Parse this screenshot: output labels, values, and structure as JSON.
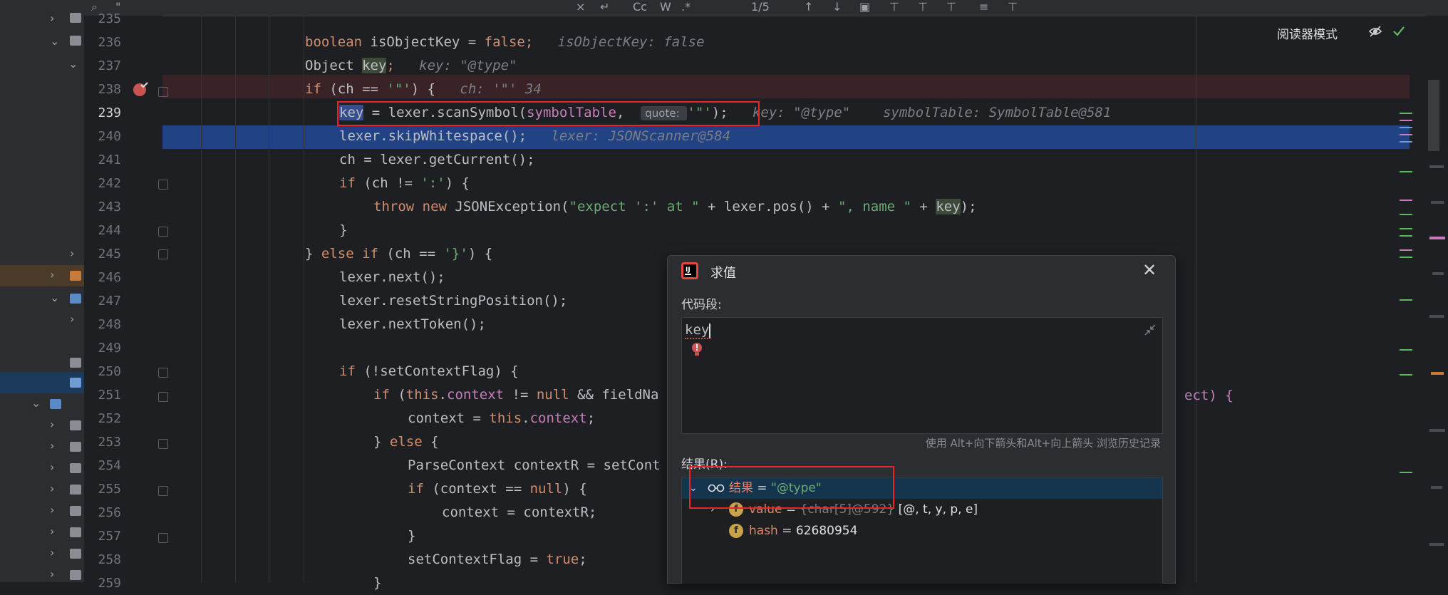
{
  "find_bar": {
    "query": "\"",
    "match_count": "1/5"
  },
  "reader_mode": {
    "label": "阅读器模式"
  },
  "lines": [
    {
      "num": "235",
      "parts": [
        {
          "t": "",
          "c": ""
        }
      ]
    },
    {
      "num": "236",
      "parts": [
        {
          "t": "boolean ",
          "c": "kw"
        },
        {
          "t": "isObjectKey = ",
          "c": ""
        },
        {
          "t": "false",
          "c": "kw"
        },
        {
          "t": ";",
          "c": "kw"
        },
        {
          "t": "   isObjectKey: false",
          "c": "hint"
        }
      ]
    },
    {
      "num": "237",
      "parts": [
        {
          "t": "Object ",
          "c": ""
        },
        {
          "t": "key",
          "c": "var-box"
        },
        {
          "t": ";",
          "c": "kw"
        },
        {
          "t": "   key: \"@type\"",
          "c": "hint"
        }
      ]
    },
    {
      "num": "238",
      "parts": [
        {
          "t": "if ",
          "c": "kw"
        },
        {
          "t": "(ch == ",
          "c": ""
        },
        {
          "t": "'\"'",
          "c": "str"
        },
        {
          "t": ") {",
          "c": ""
        },
        {
          "t": "   ch: '\"' 34",
          "c": "hint"
        }
      ]
    },
    {
      "num": "239",
      "parts": [
        {
          "t": "key",
          "c": "key-hl"
        },
        {
          "t": " = lexer.scanSymbol(",
          "c": ""
        },
        {
          "t": "symbolTable",
          "c": "fld"
        },
        {
          "t": ",  ",
          "c": ""
        },
        {
          "t": "quote: ",
          "c": "inlay-a"
        },
        {
          "t": "'\"'",
          "c": "str"
        },
        {
          "t": ");",
          "c": ""
        },
        {
          "t": "   key: \"@type\"    symbolTable: SymbolTable@581",
          "c": "hint"
        }
      ]
    },
    {
      "num": "240",
      "parts": [
        {
          "t": "lexer.skipWhitespace();",
          "c": ""
        },
        {
          "t": "   lexer: JSONScanner@584",
          "c": "hint"
        }
      ]
    },
    {
      "num": "241",
      "parts": [
        {
          "t": "ch = lexer.getCurrent();",
          "c": ""
        }
      ]
    },
    {
      "num": "242",
      "parts": [
        {
          "t": "if ",
          "c": "kw"
        },
        {
          "t": "(ch != ",
          "c": ""
        },
        {
          "t": "':'",
          "c": "str"
        },
        {
          "t": ") {",
          "c": ""
        }
      ]
    },
    {
      "num": "243",
      "parts": [
        {
          "t": "throw new ",
          "c": "kw"
        },
        {
          "t": "JSONException(",
          "c": ""
        },
        {
          "t": "\"expect ':' at \"",
          "c": "str"
        },
        {
          "t": " + lexer.pos() + ",
          "c": ""
        },
        {
          "t": "\", name \"",
          "c": "str"
        },
        {
          "t": " + ",
          "c": ""
        },
        {
          "t": "key",
          "c": "var-box"
        },
        {
          "t": ");",
          "c": ""
        }
      ]
    },
    {
      "num": "244",
      "parts": [
        {
          "t": "}",
          "c": ""
        }
      ]
    },
    {
      "num": "245",
      "parts": [
        {
          "t": "} ",
          "c": ""
        },
        {
          "t": "else if ",
          "c": "kw"
        },
        {
          "t": "(ch == ",
          "c": ""
        },
        {
          "t": "'}'",
          "c": "str"
        },
        {
          "t": ") {",
          "c": ""
        }
      ]
    },
    {
      "num": "246",
      "parts": [
        {
          "t": "lexer.next();",
          "c": ""
        }
      ]
    },
    {
      "num": "247",
      "parts": [
        {
          "t": "lexer.resetStringPosition();",
          "c": ""
        }
      ]
    },
    {
      "num": "248",
      "parts": [
        {
          "t": "lexer.nextToken();",
          "c": ""
        }
      ]
    },
    {
      "num": "249",
      "parts": [
        {
          "t": "",
          "c": ""
        }
      ]
    },
    {
      "num": "250",
      "parts": [
        {
          "t": "if ",
          "c": "kw"
        },
        {
          "t": "(!setContextFlag) {",
          "c": ""
        }
      ]
    },
    {
      "num": "251",
      "parts": [
        {
          "t": "if ",
          "c": "kw"
        },
        {
          "t": "(",
          "c": ""
        },
        {
          "t": "this",
          "c": "kw"
        },
        {
          "t": ".",
          "c": ""
        },
        {
          "t": "context",
          "c": "fld"
        },
        {
          "t": " != ",
          "c": ""
        },
        {
          "t": "null ",
          "c": "kw"
        },
        {
          "t": "&& fieldNa",
          "c": ""
        }
      ]
    },
    {
      "num": "252",
      "parts": [
        {
          "t": "context = ",
          "c": ""
        },
        {
          "t": "this",
          "c": "kw"
        },
        {
          "t": ".",
          "c": ""
        },
        {
          "t": "context",
          "c": "fld"
        },
        {
          "t": ";",
          "c": ""
        }
      ]
    },
    {
      "num": "253",
      "parts": [
        {
          "t": "} ",
          "c": ""
        },
        {
          "t": "else ",
          "c": "kw"
        },
        {
          "t": "{",
          "c": ""
        }
      ]
    },
    {
      "num": "254",
      "parts": [
        {
          "t": "ParseContext contextR = setCont",
          "c": ""
        }
      ]
    },
    {
      "num": "255",
      "parts": [
        {
          "t": "if ",
          "c": "kw"
        },
        {
          "t": "(context == ",
          "c": ""
        },
        {
          "t": "null",
          "c": "kw"
        },
        {
          "t": ") {",
          "c": ""
        }
      ]
    },
    {
      "num": "256",
      "parts": [
        {
          "t": "context = contextR;",
          "c": ""
        }
      ]
    },
    {
      "num": "257",
      "parts": [
        {
          "t": "}",
          "c": ""
        }
      ]
    },
    {
      "num": "258",
      "parts": [
        {
          "t": "setContextFlag = ",
          "c": ""
        },
        {
          "t": "true",
          "c": "kw"
        },
        {
          "t": ";",
          "c": ""
        }
      ]
    },
    {
      "num": "259",
      "parts": [
        {
          "t": "}",
          "c": ""
        }
      ]
    }
  ],
  "line251_tail": "ect) {",
  "dialog": {
    "title": "求值",
    "code_label": "代码段:",
    "expression": "key",
    "history_hint": "使用 Alt+向下箭头和Alt+向上箭头 浏览历史记录",
    "result_label": "结果(R):",
    "result_name": "结果",
    "result_value": "\"@type\"",
    "rows": [
      {
        "name": "value",
        "meta": "{char[5]@592} ",
        "value": "[@, t, y, p, e]"
      },
      {
        "name": "hash",
        "meta": "",
        "value": "62680954"
      }
    ],
    "field_badge": "f"
  }
}
